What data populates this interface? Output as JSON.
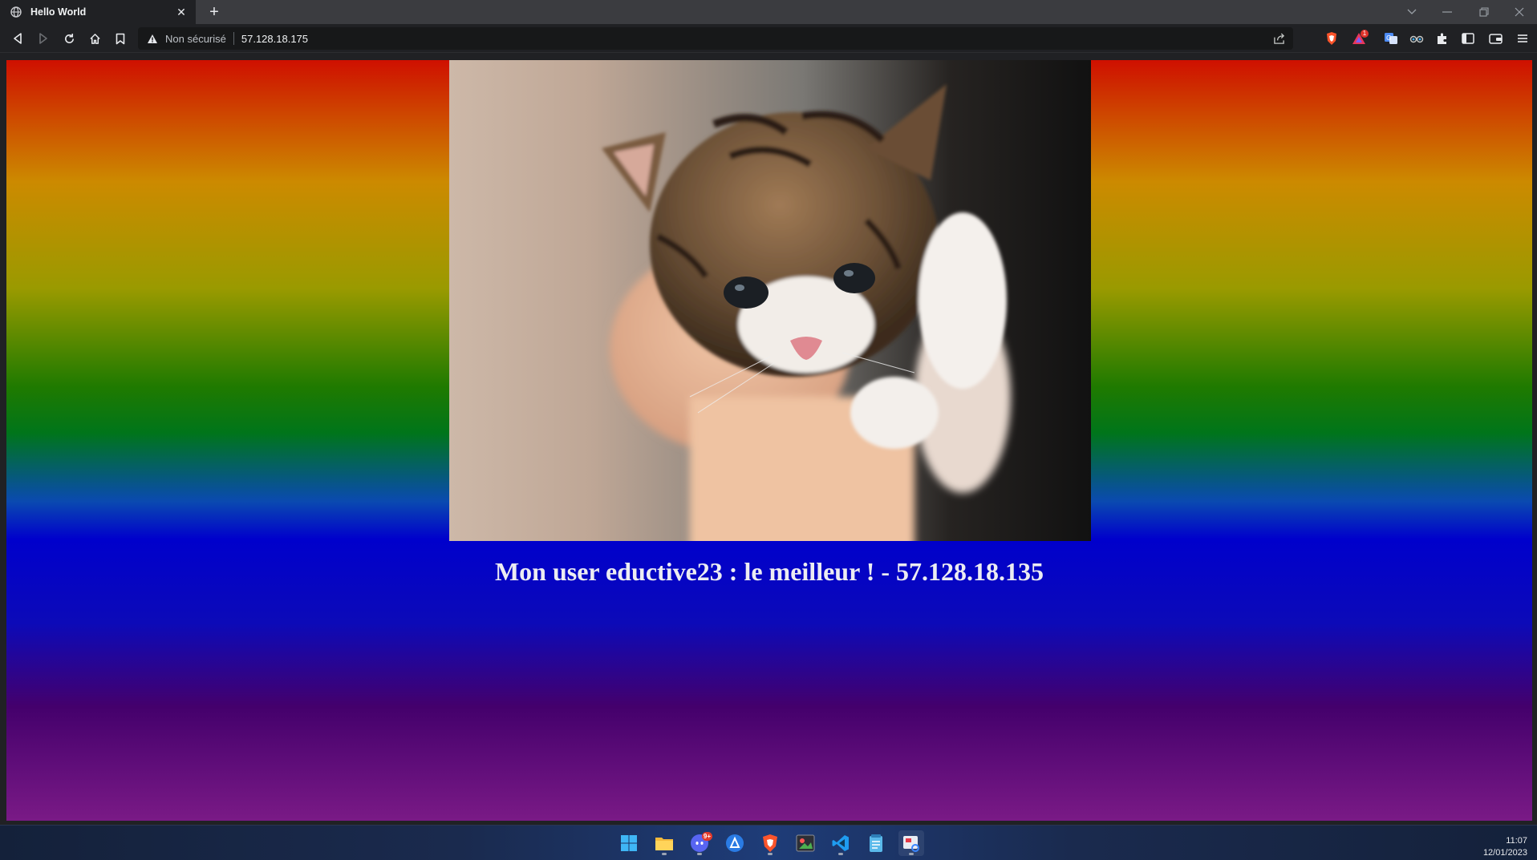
{
  "browser": {
    "tab": {
      "title": "Hello World",
      "favicon": "globe-icon",
      "close_glyph": "✕"
    },
    "new_tab_glyph": "+",
    "address_bar": {
      "security_label": "Non sécurisé",
      "url": "57.128.18.175"
    },
    "extensions": [
      {
        "name": "brave-shields-icon"
      },
      {
        "name": "brave-rewards-icon",
        "badge": "1"
      },
      {
        "name": "translate-icon"
      },
      {
        "name": "reader-glasses-icon"
      },
      {
        "name": "extensions-puzzle-icon"
      },
      {
        "name": "sidebar-icon"
      },
      {
        "name": "wallet-icon"
      },
      {
        "name": "menu-icon"
      }
    ]
  },
  "page": {
    "image_subject": "kitten-held-in-hand",
    "caption": "Mon user eductive23 : le meilleur ! - 57.128.18.135",
    "gradient_colors": [
      "#cf1000",
      "#cc8a00",
      "#9a9a00",
      "#1f7a00",
      "#0000cc",
      "#44006c",
      "#7a1a86"
    ]
  },
  "taskbar": {
    "apps": [
      {
        "name": "windows-start-icon"
      },
      {
        "name": "file-explorer-icon"
      },
      {
        "name": "discord-icon",
        "badge": "9+"
      },
      {
        "name": "copilot-icon"
      },
      {
        "name": "brave-browser-icon"
      },
      {
        "name": "paint-icon"
      },
      {
        "name": "vscode-icon"
      },
      {
        "name": "notepad-icon"
      },
      {
        "name": "snipping-tool-icon"
      }
    ],
    "clock": {
      "time": "11:07",
      "date": "12/01/2023"
    }
  }
}
